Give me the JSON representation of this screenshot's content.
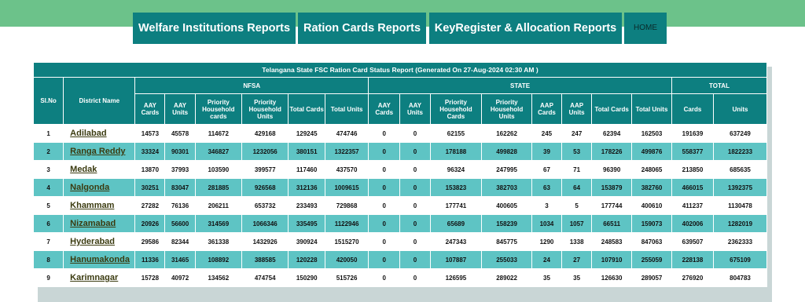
{
  "nav": {
    "welfare": "Welfare Institutions Reports",
    "ration": "Ration Cards Reports",
    "keyregister": "KeyRegister & Allocation Reports",
    "home": "HOME"
  },
  "table": {
    "caption": "Telangana State FSC Ration Card Status Report (Generated On 27-Aug-2024 02:30 AM )",
    "groups": {
      "nfsa": "NFSA",
      "state": "STATE",
      "total": "TOTAL"
    },
    "col_slno": "Sl.No",
    "col_district": "District Name",
    "nfsa_cols": [
      "AAY Cards",
      "AAY Units",
      "Priority Household cards",
      "Priority Household Units",
      "Total Cards",
      "Total Units"
    ],
    "state_cols": [
      "AAY Cards",
      "AAY Units",
      "Priority Household Cards",
      "Priority Household Units",
      "AAP Cards",
      "AAP Units",
      "Total Cards",
      "Total Units"
    ],
    "total_cols": [
      "Cards",
      "Units"
    ],
    "rows": [
      {
        "sl": "1",
        "district": "Adilabad",
        "v": [
          "14573",
          "45578",
          "114672",
          "429168",
          "129245",
          "474746",
          "0",
          "0",
          "62155",
          "162262",
          "245",
          "247",
          "62394",
          "162503",
          "191639",
          "637249"
        ]
      },
      {
        "sl": "2",
        "district": "Ranga Reddy",
        "v": [
          "33324",
          "90301",
          "346827",
          "1232056",
          "380151",
          "1322357",
          "0",
          "0",
          "178188",
          "499828",
          "39",
          "53",
          "178226",
          "499876",
          "558377",
          "1822233"
        ]
      },
      {
        "sl": "3",
        "district": "Medak",
        "v": [
          "13870",
          "37993",
          "103590",
          "399577",
          "117460",
          "437570",
          "0",
          "0",
          "96324",
          "247995",
          "67",
          "71",
          "96390",
          "248065",
          "213850",
          "685635"
        ]
      },
      {
        "sl": "4",
        "district": "Nalgonda",
        "v": [
          "30251",
          "83047",
          "281885",
          "926568",
          "312136",
          "1009615",
          "0",
          "0",
          "153823",
          "382703",
          "63",
          "64",
          "153879",
          "382760",
          "466015",
          "1392375"
        ]
      },
      {
        "sl": "5",
        "district": "Khammam",
        "v": [
          "27282",
          "76136",
          "206211",
          "653732",
          "233493",
          "729868",
          "0",
          "0",
          "177741",
          "400605",
          "3",
          "5",
          "177744",
          "400610",
          "411237",
          "1130478"
        ]
      },
      {
        "sl": "6",
        "district": "Nizamabad",
        "v": [
          "20926",
          "56600",
          "314569",
          "1066346",
          "335495",
          "1122946",
          "0",
          "0",
          "65689",
          "158239",
          "1034",
          "1057",
          "66511",
          "159073",
          "402006",
          "1282019"
        ]
      },
      {
        "sl": "7",
        "district": "Hyderabad",
        "v": [
          "29586",
          "82344",
          "361338",
          "1432926",
          "390924",
          "1515270",
          "0",
          "0",
          "247343",
          "845775",
          "1290",
          "1338",
          "248583",
          "847063",
          "639507",
          "2362333"
        ]
      },
      {
        "sl": "8",
        "district": "Hanumakonda",
        "v": [
          "11336",
          "31465",
          "108892",
          "388585",
          "120228",
          "420050",
          "0",
          "0",
          "107887",
          "255033",
          "24",
          "27",
          "107910",
          "255059",
          "228138",
          "675109"
        ]
      },
      {
        "sl": "9",
        "district": "Karimnagar",
        "v": [
          "15728",
          "40972",
          "134562",
          "474754",
          "150290",
          "515726",
          "0",
          "0",
          "126595",
          "289022",
          "35",
          "35",
          "126630",
          "289057",
          "276920",
          "804783"
        ]
      }
    ]
  }
}
